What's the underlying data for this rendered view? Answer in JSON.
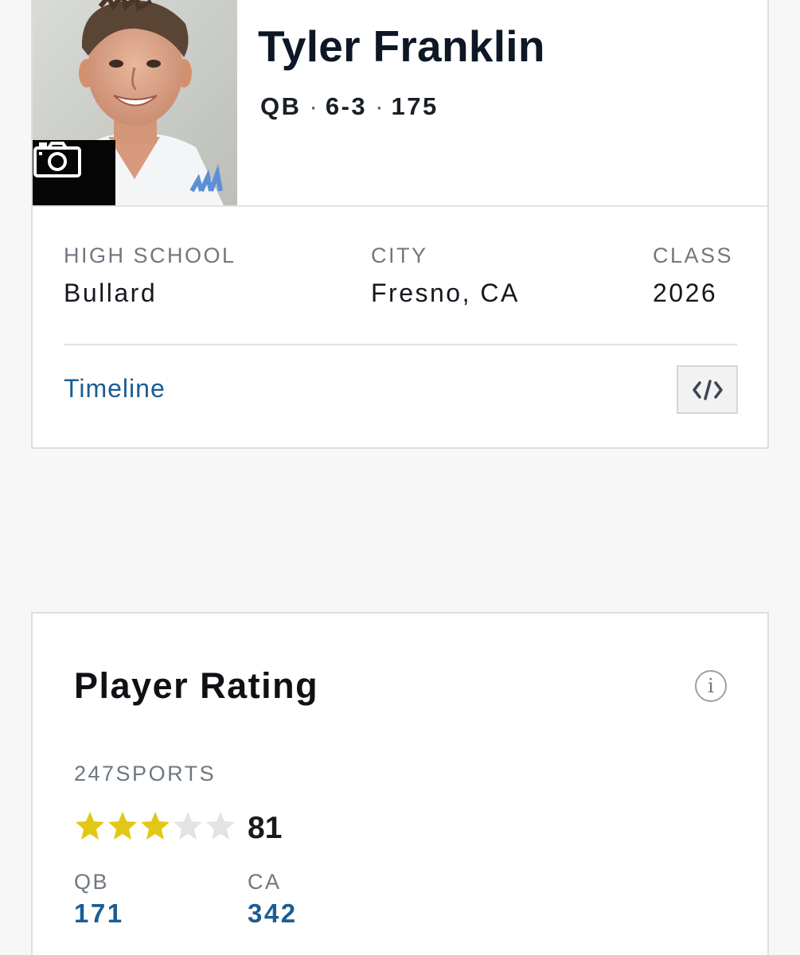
{
  "player": {
    "name": "Tyler Franklin",
    "position": "QB",
    "height": "6-3",
    "weight": "175",
    "separator": "·"
  },
  "details": {
    "high_school_label": "HIGH SCHOOL",
    "high_school_value": "Bullard",
    "city_label": "CITY",
    "city_value": "Fresno, CA",
    "class_label": "CLASS",
    "class_value": "2026"
  },
  "links": {
    "timeline": "Timeline",
    "embed_icon": "code-embed-icon"
  },
  "photo": {
    "camera_icon": "camera-icon"
  },
  "rating": {
    "title": "Player Rating",
    "info_icon": "i",
    "provider": "247SPORTS",
    "stars_filled": 3,
    "stars_total": 5,
    "score": "81",
    "position_rank_label": "QB",
    "position_rank_value": "171",
    "state_rank_label": "CA",
    "state_rank_value": "342"
  },
  "colors": {
    "link_blue": "#1c5d93",
    "star_gold": "#e2c814",
    "star_empty": "#e3e3e3"
  }
}
